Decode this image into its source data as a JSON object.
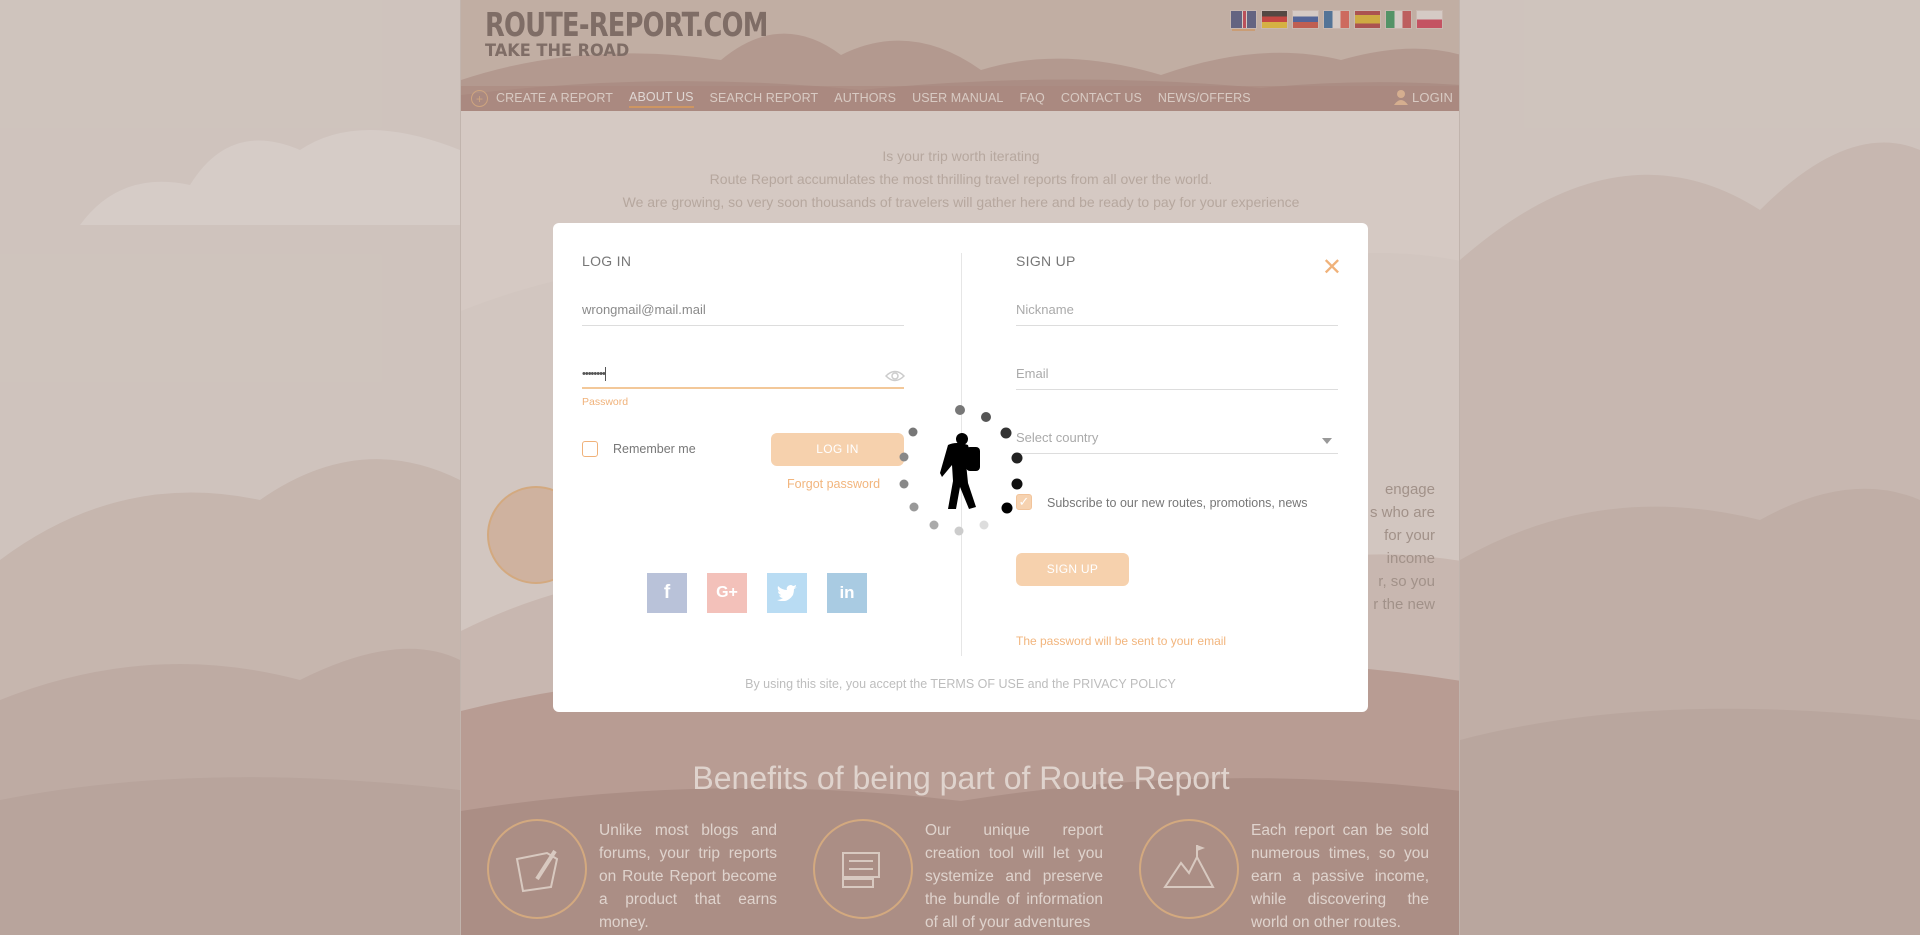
{
  "header": {
    "logo_line1": "ROUTE-REPORT.COM",
    "logo_line2": "TAKE THE ROAD",
    "flags": [
      "English",
      "German",
      "Russian",
      "French",
      "Spanish",
      "Italian",
      "Polish"
    ],
    "nav": [
      "CREATE A REPORT",
      "ABOUT US",
      "SEARCH REPORT",
      "AUTHORS",
      "USER MANUAL",
      "FAQ",
      "CONTACT US",
      "NEWS/OFFERS"
    ],
    "nav_active": "ABOUT US",
    "login_label": "LOGIN"
  },
  "intro": {
    "line1": "Is your trip worth iterating",
    "line2": "Route Report accumulates the most thrilling travel reports from all over the world.",
    "line3": "We are growing, so very soon thousands of travelers will gather here and be ready to pay for your experience"
  },
  "side_text": [
    "engage",
    "s who are",
    "for your",
    "income",
    "r, so you",
    "r the new"
  ],
  "benefits": {
    "title": "Benefits of being part of Route Report",
    "items": [
      {
        "text": "Unlike most blogs and forums, your trip reports on Route Report become a product that earns money.",
        "icon": "map-pencil-icon"
      },
      {
        "text": "Our unique report creation tool will let you systemize and preserve the bundle of information of all of your adventures",
        "icon": "report-tool-icon"
      },
      {
        "text": "Each report can be sold numerous times, so you earn a passive income, while discovering the world on other routes.",
        "icon": "mountain-flag-icon"
      }
    ]
  },
  "modal": {
    "login": {
      "title": "LOG IN",
      "email_value": "wrongmail@mail.mail",
      "password_value": "••••••••",
      "password_label": "Password",
      "remember_label": "Remember me",
      "button": "LOG IN",
      "forgot": "Forgot password",
      "social": [
        "facebook",
        "google-plus",
        "twitter",
        "linkedin"
      ]
    },
    "signup": {
      "title": "SIGN UP",
      "nickname_placeholder": "Nickname",
      "email_placeholder": "Email",
      "country_placeholder": "Select country",
      "subscribe_label": "Subscribe to our new routes, promotions, news",
      "button": "SIGN UP",
      "note": "The password will be sent to your email"
    },
    "terms": "By using this site, you accept the TERMS OF USE and the PRIVACY POLICY"
  },
  "colors": {
    "accent": "#f0b27a",
    "button": "#f6d1ad",
    "facebook": "#b9c2d9",
    "google": "#f3c1ba",
    "twitter": "#b9dcf3",
    "linkedin": "#a9cbe2"
  }
}
